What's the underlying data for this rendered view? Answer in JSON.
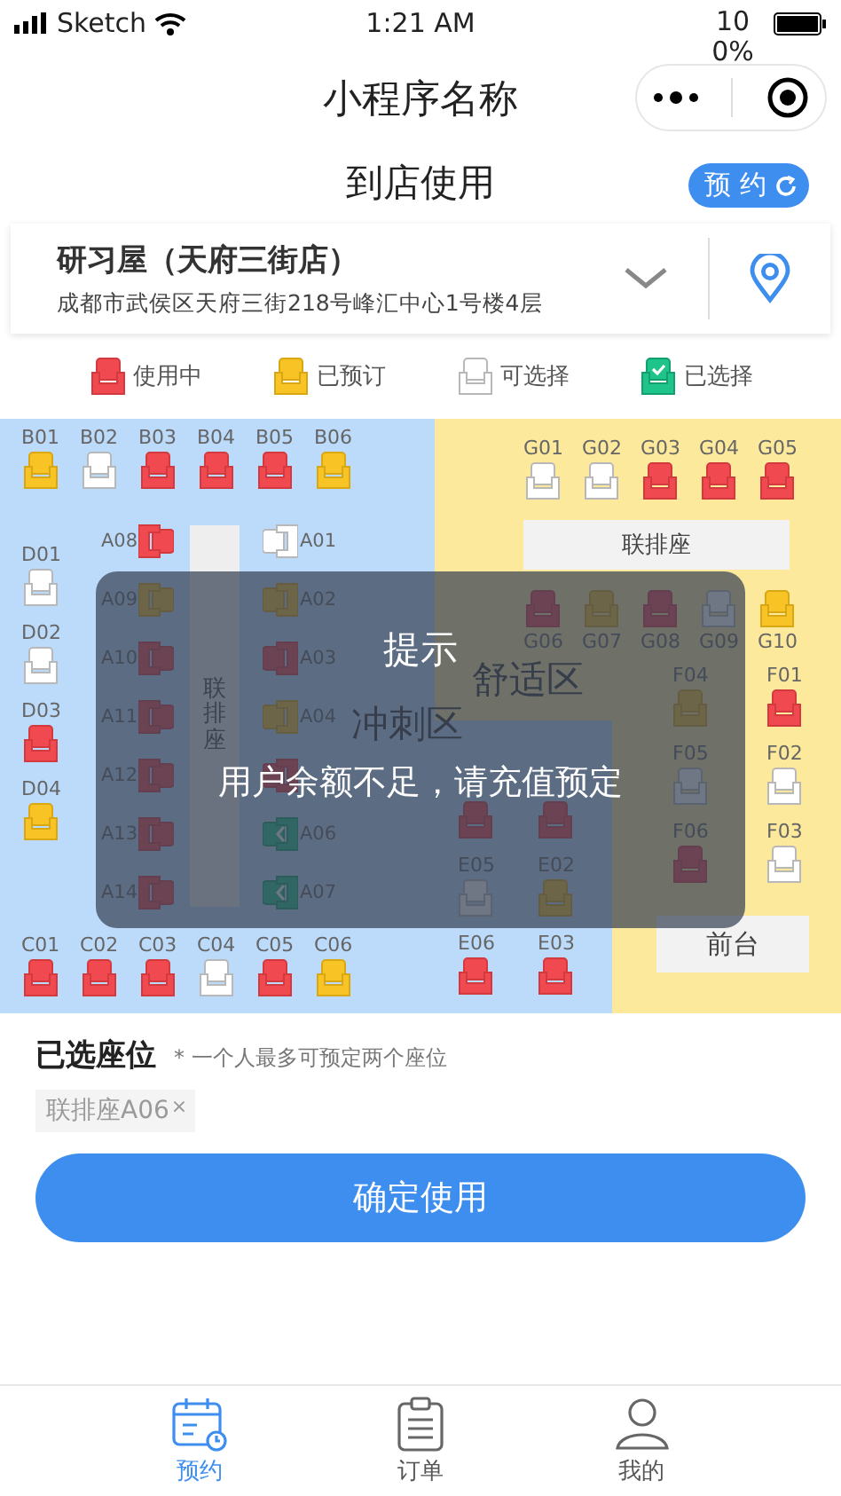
{
  "status_bar": {
    "carrier": "Sketch",
    "time": "1:21 AM",
    "battery": "100%"
  },
  "title_bar": {
    "title": "小程序名称"
  },
  "header": {
    "title": "到店使用",
    "button": "预 约"
  },
  "store": {
    "name": "研习屋（天府三街店）",
    "address": "成都市武侯区天府三街218号峰汇中心1号楼4层"
  },
  "legend": [
    {
      "kind": "occupied",
      "label": "使用中"
    },
    {
      "kind": "reserved",
      "label": "已预订"
    },
    {
      "kind": "available",
      "label": "可选择"
    },
    {
      "kind": "selected",
      "label": "已选择"
    }
  ],
  "seat_map": {
    "zones": [
      "舒适区",
      "冲刺区"
    ],
    "bench_labels": [
      "联排座",
      "联排座"
    ],
    "front_desk": "前台",
    "groups": [
      {
        "seats": [
          {
            "label": "B01",
            "kind": "reserved"
          },
          {
            "label": "B02",
            "kind": "available"
          },
          {
            "label": "B03",
            "kind": "occupied"
          },
          {
            "label": "B04",
            "kind": "occupied"
          },
          {
            "label": "B05",
            "kind": "occupied"
          },
          {
            "label": "B06",
            "kind": "reserved"
          }
        ]
      },
      {
        "seats": [
          {
            "label": "D01",
            "kind": "available"
          },
          {
            "label": "D02",
            "kind": "available"
          },
          {
            "label": "D03",
            "kind": "occupied"
          },
          {
            "label": "D04",
            "kind": "reserved"
          }
        ]
      },
      {
        "seats": [
          {
            "label": "A08",
            "kind": "occupied"
          },
          {
            "label": "A09",
            "kind": "reserved"
          },
          {
            "label": "A10",
            "kind": "occupied"
          },
          {
            "label": "A11",
            "kind": "occupied"
          },
          {
            "label": "A12",
            "kind": "occupied"
          },
          {
            "label": "A13",
            "kind": "occupied"
          },
          {
            "label": "A14",
            "kind": "occupied"
          }
        ]
      },
      {
        "seats": [
          {
            "label": "A01",
            "kind": "available"
          },
          {
            "label": "A02",
            "kind": "reserved"
          },
          {
            "label": "A03",
            "kind": "occupied"
          },
          {
            "label": "A04",
            "kind": "reserved"
          },
          {
            "kind": "occupied"
          },
          {
            "label": "A06",
            "kind": "selected"
          },
          {
            "label": "A07",
            "kind": "selected"
          }
        ]
      },
      {
        "seats": [
          {
            "label": "C01",
            "kind": "occupied"
          },
          {
            "label": "C02",
            "kind": "occupied"
          },
          {
            "label": "C03",
            "kind": "occupied"
          },
          {
            "label": "C04",
            "kind": "available"
          },
          {
            "label": "C05",
            "kind": "occupied"
          },
          {
            "label": "C06",
            "kind": "reserved"
          }
        ]
      },
      {
        "seats": [
          {
            "label": "G01",
            "kind": "available"
          },
          {
            "label": "G02",
            "kind": "available"
          },
          {
            "label": "G03",
            "kind": "occupied"
          },
          {
            "label": "G04",
            "kind": "occupied"
          },
          {
            "label": "G05",
            "kind": "occupied"
          }
        ]
      },
      {
        "seats": [
          {
            "label": "G06",
            "kind": "occupied"
          },
          {
            "label": "G07",
            "kind": "reserved"
          },
          {
            "label": "G08",
            "kind": "occupied"
          },
          {
            "label": "G09",
            "kind": "available"
          },
          {
            "label": "G10",
            "kind": "reserved"
          }
        ]
      },
      {
        "seats": [
          {
            "label": "F04",
            "kind": "reserved"
          },
          {
            "label": "F05",
            "kind": "available"
          },
          {
            "label": "F06",
            "kind": "occupied"
          }
        ]
      },
      {
        "seats": [
          {
            "label": "F01",
            "kind": "occupied"
          },
          {
            "label": "F02",
            "kind": "available"
          },
          {
            "label": "F03",
            "kind": "available"
          }
        ]
      },
      {
        "seats": [
          {
            "kind": "occupied"
          },
          {
            "kind": "occupied"
          },
          {
            "label": "E05",
            "kind": "available"
          },
          {
            "label": "E02",
            "kind": "reserved"
          },
          {
            "label": "E06",
            "kind": "occupied"
          },
          {
            "label": "E03",
            "kind": "occupied"
          }
        ]
      }
    ]
  },
  "dialog": {
    "title": "提示",
    "message": "用户余额不足，请充值预定"
  },
  "selection": {
    "title": "已选座位",
    "note": "* 一个人最多可预定两个座位",
    "chips": [
      {
        "label": "联排座A06",
        "remove": "×"
      }
    ]
  },
  "confirm_button": "确定使用",
  "tab_bar": [
    {
      "label": "预约",
      "selected": true
    },
    {
      "label": "订单",
      "selected": false
    },
    {
      "label": "我的",
      "selected": false
    }
  ]
}
